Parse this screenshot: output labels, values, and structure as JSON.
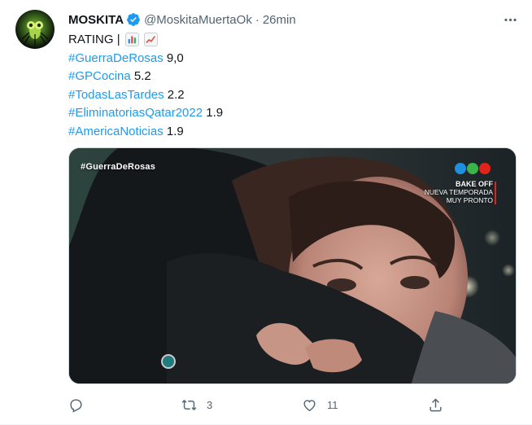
{
  "tweet": {
    "author": {
      "display_name": "MOSKITA",
      "handle": "@MoskitaMuertaOk",
      "verified": true
    },
    "separator": "·",
    "time": "26min",
    "text_lines": [
      {
        "prefix": "RATING | ",
        "emojis": [
          "bar-chart-emoji",
          "chart-increasing-emoji"
        ]
      },
      {
        "hashtag": "#GuerraDeRosas",
        "value": "9,0"
      },
      {
        "hashtag": "#GPCocina",
        "value": "5.2"
      },
      {
        "hashtag": "#TodasLasTardes",
        "value": "2.2"
      },
      {
        "hashtag": "#EliminatoriasQatar2022",
        "value": "1.9"
      },
      {
        "hashtag": "#AmericaNoticias",
        "value": "1.9"
      }
    ],
    "media": {
      "overlay_tag": "#GuerraDeRosas",
      "promo_title": "BAKE OFF",
      "promo_line2": "NUEVA TEMPORADA",
      "promo_line3": "MUY PRONTO",
      "logo_colors": [
        "#1f8fe0",
        "#3ab54a",
        "#e2231a"
      ]
    },
    "actions": {
      "reply_count": "",
      "retweet_count": "3",
      "like_count": "11",
      "share_count": ""
    },
    "colors": {
      "link": "#1d9bf0",
      "muted": "#536471",
      "text": "#0f1419"
    }
  }
}
